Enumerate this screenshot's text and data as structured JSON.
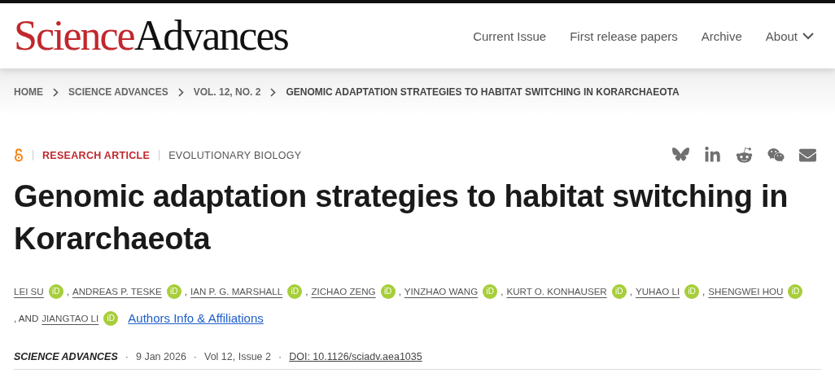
{
  "header": {
    "logo": {
      "first": "Science",
      "second": "Advances"
    },
    "nav": [
      {
        "label": "Current Issue",
        "dropdown": false
      },
      {
        "label": "First release papers",
        "dropdown": false
      },
      {
        "label": "Archive",
        "dropdown": false
      },
      {
        "label": "About",
        "dropdown": true
      }
    ]
  },
  "breadcrumbs": [
    {
      "label": "HOME",
      "current": false
    },
    {
      "label": "SCIENCE ADVANCES",
      "current": false
    },
    {
      "label": "VOL. 12, NO. 2",
      "current": false
    },
    {
      "label": "GENOMIC ADAPTATION STRATEGIES TO HABITAT SWITCHING IN KORARCHAEOTA",
      "current": true
    }
  ],
  "article": {
    "open_access": true,
    "type": "RESEARCH ARTICLE",
    "subject": "EVOLUTIONARY BIOLOGY",
    "share": [
      {
        "kind": "bluesky"
      },
      {
        "kind": "linkedin"
      },
      {
        "kind": "reddit"
      },
      {
        "kind": "wechat"
      },
      {
        "kind": "email"
      }
    ],
    "title": "Genomic adaptation strategies to habitat switching in Korarchaeota",
    "authors": [
      {
        "name": "LEI SU",
        "orcid": "iD",
        "after": ","
      },
      {
        "name": "ANDREAS P. TESKE",
        "orcid": "iD",
        "after": ","
      },
      {
        "name": "IAN P. G. MARSHALL",
        "orcid": "iD",
        "after": ","
      },
      {
        "name": "ZICHAO ZENG",
        "orcid": "iD",
        "after": ","
      },
      {
        "name": "YINZHAO WANG",
        "orcid": "iD",
        "after": ","
      },
      {
        "name": "KURT O. KONHAUSER",
        "orcid": "iD",
        "after": ","
      },
      {
        "name": "YUHAO LI",
        "orcid": "iD",
        "after": ","
      },
      {
        "name": "SHENGWEI HOU",
        "orcid": "iD",
        "after": ", AND"
      },
      {
        "name": "JIANGTAO LI",
        "orcid": "iD"
      }
    ],
    "affiliations_link": "Authors Info & Affiliations",
    "journal": "SCIENCE ADVANCES",
    "date": "9 Jan 2026",
    "issue": "Vol 12, Issue 2",
    "doi": "DOI: 10.1126/sciadv.aea1035",
    "dots": [
      "·",
      "·",
      "·"
    ]
  }
}
